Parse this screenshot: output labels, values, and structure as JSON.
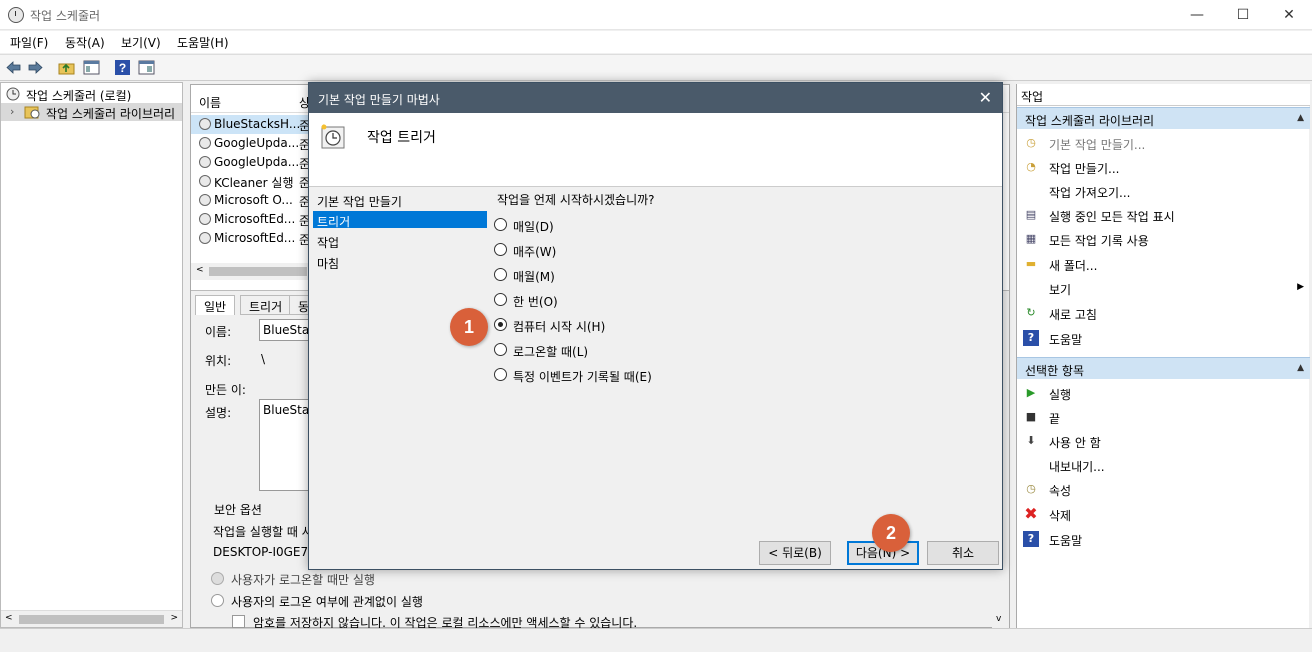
{
  "window": {
    "title": "작업 스케줄러",
    "minimize": "—",
    "maximize": "☐",
    "close": "✕"
  },
  "menu": [
    "파일(F)",
    "동작(A)",
    "보기(V)",
    "도움말(H)"
  ],
  "tree": {
    "root": "작업 스케줄러 (로컬)",
    "child": "작업 스케줄러 라이브러리"
  },
  "tasks": {
    "col_name": "이름",
    "col_status": "상",
    "rows": [
      {
        "name": "BlueStacksH...",
        "status": "준"
      },
      {
        "name": "GoogleUpda...",
        "status": "준"
      },
      {
        "name": "GoogleUpda...",
        "status": "준"
      },
      {
        "name": "KCleaner 실행",
        "status": "준"
      },
      {
        "name": "Microsoft O...",
        "status": "준"
      },
      {
        "name": "MicrosoftEd...",
        "status": "준"
      },
      {
        "name": "MicrosoftEd...",
        "status": "준"
      }
    ]
  },
  "details": {
    "tabs": [
      "일반",
      "트리거",
      "동"
    ],
    "name_label": "이름:",
    "name_value": "BlueStac",
    "location_label": "위치:",
    "location_value": "\\",
    "author_label": "만든 이:",
    "desc_label": "설명:",
    "desc_value": "BlueStac",
    "security_title": "보안 옵션",
    "security_run_label": "작업을 실행할 때 사",
    "security_account": "DESKTOP-I0GE7UC",
    "opt_logged_on": "사용자가 로그온할 때만 실행",
    "opt_regardless": "사용자의 로그온 여부에 관계없이 실행",
    "opt_no_password": "암호를 저장하지 않습니다. 이 작업은 로컬 리소스에만 액세스할 수 있습니다."
  },
  "actions": {
    "header": "작업",
    "section1": "작업 스케줄러 라이브러리",
    "items1": [
      {
        "label": "기본 작업 만들기...",
        "icon": "create-basic-task-icon",
        "disabled": true
      },
      {
        "label": "작업 만들기...",
        "icon": "create-task-icon"
      },
      {
        "label": "작업 가져오기...",
        "icon": ""
      },
      {
        "label": "실행 중인 모든 작업 표시",
        "icon": "running-tasks-icon"
      },
      {
        "label": "모든 작업 기록 사용",
        "icon": "history-icon"
      },
      {
        "label": "새 폴더...",
        "icon": "new-folder-icon"
      },
      {
        "label": "보기",
        "icon": ""
      },
      {
        "label": "새로 고침",
        "icon": "refresh-icon"
      },
      {
        "label": "도움말",
        "icon": "help-icon"
      }
    ],
    "section2": "선택한 항목",
    "items2": [
      {
        "label": "실행",
        "icon": "run-icon"
      },
      {
        "label": "끝",
        "icon": "end-icon"
      },
      {
        "label": "사용 안 함",
        "icon": "disable-icon"
      },
      {
        "label": "내보내기...",
        "icon": ""
      },
      {
        "label": "속성",
        "icon": "properties-icon"
      },
      {
        "label": "삭제",
        "icon": "delete-icon"
      },
      {
        "label": "도움말",
        "icon": "help-icon"
      }
    ]
  },
  "wizard": {
    "title": "기본 작업 만들기 마법사",
    "close": "✕",
    "header_title": "작업 트리거",
    "steps": [
      "기본 작업 만들기",
      "트리거",
      "작업",
      "마침"
    ],
    "active_step": 1,
    "question": "작업을 언제 시작하시겠습니까?",
    "options": [
      "매일(D)",
      "매주(W)",
      "매월(M)",
      "한 번(O)",
      "컴퓨터 시작 시(H)",
      "로그온할 때(L)",
      "특정 이벤트가 기록될 때(E)"
    ],
    "selected_option": 4,
    "btn_back": "< 뒤로(B)",
    "btn_next": "다음(N) >",
    "btn_cancel": "취소"
  },
  "callouts": [
    "1",
    "2"
  ],
  "colors": {
    "accent": "#0078d7",
    "callout": "#d9603a",
    "dialog_title": "#4a5a6a",
    "section_bg": "#cfe3f4"
  }
}
